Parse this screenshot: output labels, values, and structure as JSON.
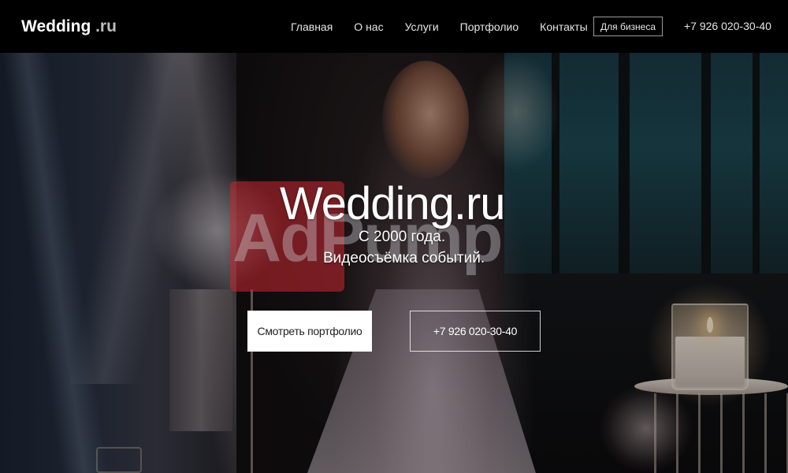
{
  "header": {
    "logo_main": "Wedding",
    "logo_tld": " .ru",
    "nav": [
      "Главная",
      "О нас",
      "Услуги",
      "Портфолио",
      "Контакты"
    ],
    "business_button": "Для бизнеса",
    "phone": "+7 926 020-30-40"
  },
  "hero": {
    "title": "Wedding.ru",
    "subtitle_line1": "С 2000 года.",
    "subtitle_line2": "Видеосъёмка событий.",
    "portfolio_button": "Смотреть портфолио",
    "phone_button": "+7 926 020-30-40"
  },
  "watermark": {
    "text": "AdPump"
  },
  "colors": {
    "header_bg": "#000000",
    "watermark_red": "#c82832",
    "button_bg": "#ffffff"
  }
}
